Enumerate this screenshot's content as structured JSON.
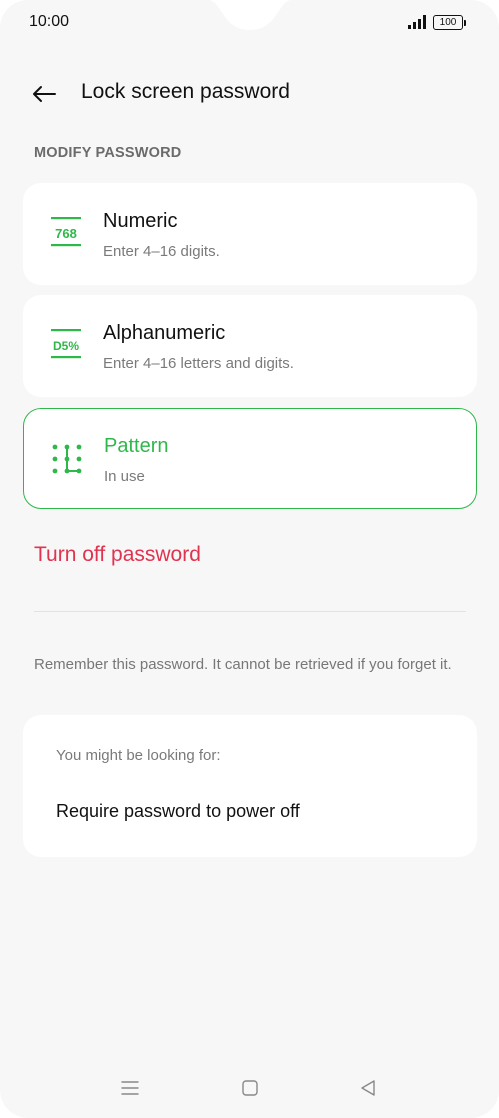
{
  "status_bar": {
    "time": "10:00",
    "battery": "100"
  },
  "header": {
    "title": "Lock screen password",
    "back_icon": "arrow-left-icon"
  },
  "section": {
    "label": "MODIFY PASSWORD"
  },
  "options": [
    {
      "title": "Numeric",
      "subtitle": "Enter 4–16 digits.",
      "icon": "numeric-icon",
      "icon_text": "768",
      "selected": false
    },
    {
      "title": "Alphanumeric",
      "subtitle": "Enter 4–16 letters and digits.",
      "icon": "alphanumeric-icon",
      "icon_text": "D5%",
      "selected": false
    },
    {
      "title": "Pattern",
      "subtitle": "In use",
      "icon": "pattern-icon",
      "selected": true
    }
  ],
  "turn_off_label": "Turn off password",
  "note": "Remember this password. It cannot be retrieved if you forget it.",
  "suggestions": {
    "label": "You might be looking for:",
    "items": [
      "Require password to power off"
    ]
  },
  "nav": {
    "menu_icon": "menu-icon",
    "home_icon": "home-square-icon",
    "back_icon": "back-triangle-icon"
  },
  "colors": {
    "accent_green": "#2fb84a",
    "danger_red": "#e0334f",
    "background": "#f7f7f7",
    "card": "#ffffff"
  }
}
